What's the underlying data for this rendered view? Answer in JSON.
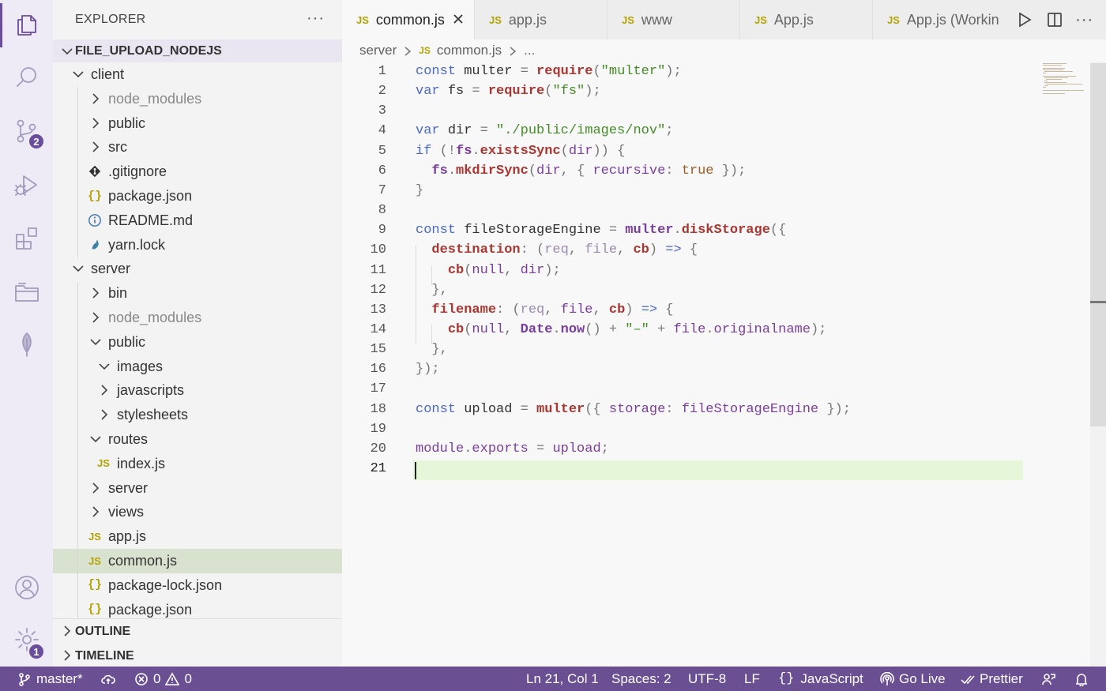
{
  "activity_bar": {
    "items": [
      {
        "name": "explorer",
        "icon": "files-icon",
        "active": true
      },
      {
        "name": "search",
        "icon": "search-icon"
      },
      {
        "name": "source-control",
        "icon": "source-control-icon",
        "badge": "2"
      },
      {
        "name": "run-debug",
        "icon": "debug-icon"
      },
      {
        "name": "extensions",
        "icon": "extensions-icon"
      },
      {
        "name": "remote-explorer",
        "icon": "folder-icon"
      },
      {
        "name": "mongodb",
        "icon": "leaf-icon"
      }
    ],
    "bottom": [
      {
        "name": "accounts",
        "icon": "account-icon"
      },
      {
        "name": "manage",
        "icon": "gear-icon",
        "badge": "1"
      }
    ]
  },
  "sidebar": {
    "title": "EXPLORER",
    "more": "···",
    "project": "FILE_UPLOAD_NODEJS",
    "tree": [
      {
        "label": "client",
        "type": "folder",
        "open": true,
        "depth": 1
      },
      {
        "label": "node_modules",
        "type": "folder",
        "open": false,
        "depth": 2,
        "dim": true
      },
      {
        "label": "public",
        "type": "folder",
        "open": false,
        "depth": 2
      },
      {
        "label": "src",
        "type": "folder",
        "open": false,
        "depth": 2
      },
      {
        "label": ".gitignore",
        "type": "git",
        "depth": 2
      },
      {
        "label": "package.json",
        "type": "json",
        "depth": 2
      },
      {
        "label": "README.md",
        "type": "info",
        "depth": 2
      },
      {
        "label": "yarn.lock",
        "type": "yarn",
        "depth": 2
      },
      {
        "label": "server",
        "type": "folder",
        "open": true,
        "depth": 1
      },
      {
        "label": "bin",
        "type": "folder",
        "open": false,
        "depth": 2
      },
      {
        "label": "node_modules",
        "type": "folder",
        "open": false,
        "depth": 2,
        "dim": true
      },
      {
        "label": "public",
        "type": "folder",
        "open": true,
        "depth": 2
      },
      {
        "label": "images",
        "type": "folder",
        "open": true,
        "depth": 3
      },
      {
        "label": "javascripts",
        "type": "folder",
        "open": false,
        "depth": 3
      },
      {
        "label": "stylesheets",
        "type": "folder",
        "open": false,
        "depth": 3
      },
      {
        "label": "routes",
        "type": "folder",
        "open": true,
        "depth": 2
      },
      {
        "label": "index.js",
        "type": "js",
        "depth": 3
      },
      {
        "label": "server",
        "type": "folder",
        "open": false,
        "depth": 2
      },
      {
        "label": "views",
        "type": "folder",
        "open": false,
        "depth": 2
      },
      {
        "label": "app.js",
        "type": "js",
        "depth": 2
      },
      {
        "label": "common.js",
        "type": "js",
        "depth": 2,
        "selected": true
      },
      {
        "label": "package-lock.json",
        "type": "json",
        "depth": 2
      },
      {
        "label": "package.json",
        "type": "json",
        "depth": 2
      }
    ],
    "sections": [
      "OUTLINE",
      "TIMELINE"
    ]
  },
  "tabs": [
    {
      "label": "common.js",
      "active": true,
      "closable": true
    },
    {
      "label": "app.js"
    },
    {
      "label": "www"
    },
    {
      "label": "App.js"
    },
    {
      "label": "App.js (Working Tree)"
    }
  ],
  "tab_actions": {
    "more": "···"
  },
  "breadcrumb": {
    "folder": "server",
    "file": "common.js",
    "symbol": "..."
  },
  "code": [
    [
      [
        "kw",
        "const "
      ],
      [
        "var",
        "multer "
      ],
      [
        "punc",
        "= "
      ],
      [
        "fn",
        "require"
      ],
      [
        "punc",
        "("
      ],
      [
        "str",
        "\"multer\""
      ],
      [
        "punc",
        ");"
      ]
    ],
    [
      [
        "kw",
        "var "
      ],
      [
        "var",
        "fs "
      ],
      [
        "punc",
        "= "
      ],
      [
        "fn",
        "require"
      ],
      [
        "punc",
        "("
      ],
      [
        "str",
        "\"fs\""
      ],
      [
        "punc",
        ");"
      ]
    ],
    [],
    [
      [
        "kw",
        "var "
      ],
      [
        "var",
        "dir "
      ],
      [
        "punc",
        "= "
      ],
      [
        "str",
        "\"./public/images/nov\""
      ],
      [
        "punc",
        ";"
      ]
    ],
    [
      [
        "kw",
        "if "
      ],
      [
        "punc",
        "(!"
      ],
      [
        "obj",
        "fs"
      ],
      [
        "punc",
        "."
      ],
      [
        "fn",
        "existsSync"
      ],
      [
        "punc",
        "("
      ],
      [
        "prop",
        "dir"
      ],
      [
        "punc",
        ")) {"
      ]
    ],
    [
      [
        "var",
        "  "
      ],
      [
        "obj",
        "fs"
      ],
      [
        "punc",
        "."
      ],
      [
        "fn",
        "mkdirSync"
      ],
      [
        "punc",
        "("
      ],
      [
        "prop",
        "dir"
      ],
      [
        "punc",
        ", { "
      ],
      [
        "prop",
        "recursive"
      ],
      [
        "punc",
        ": "
      ],
      [
        "bool",
        "true"
      ],
      [
        "punc",
        " });"
      ]
    ],
    [
      [
        "punc",
        "}"
      ]
    ],
    [],
    [
      [
        "kw",
        "const "
      ],
      [
        "var",
        "fileStorageEngine "
      ],
      [
        "punc",
        "= "
      ],
      [
        "obj",
        "multer"
      ],
      [
        "punc",
        "."
      ],
      [
        "fn",
        "diskStorage"
      ],
      [
        "punc",
        "({"
      ]
    ],
    [
      [
        "var",
        "  "
      ],
      [
        "fn",
        "destination"
      ],
      [
        "punc",
        ": ("
      ],
      [
        "param",
        "req"
      ],
      [
        "punc",
        ", "
      ],
      [
        "param",
        "file"
      ],
      [
        "punc",
        ", "
      ],
      [
        "fn",
        "cb"
      ],
      [
        "punc",
        ") "
      ],
      [
        "kw",
        "=>"
      ],
      [
        "punc",
        " {"
      ]
    ],
    [
      [
        "var",
        "    "
      ],
      [
        "fn",
        "cb"
      ],
      [
        "punc",
        "("
      ],
      [
        "prop",
        "null"
      ],
      [
        "punc",
        ", "
      ],
      [
        "prop",
        "dir"
      ],
      [
        "punc",
        ");"
      ]
    ],
    [
      [
        "var",
        "  "
      ],
      [
        "punc",
        "},"
      ]
    ],
    [
      [
        "var",
        "  "
      ],
      [
        "fn",
        "filename"
      ],
      [
        "punc",
        ": ("
      ],
      [
        "param",
        "req"
      ],
      [
        "punc",
        ", "
      ],
      [
        "prop",
        "file"
      ],
      [
        "punc",
        ", "
      ],
      [
        "fn",
        "cb"
      ],
      [
        "punc",
        ") "
      ],
      [
        "kw",
        "=>"
      ],
      [
        "punc",
        " {"
      ]
    ],
    [
      [
        "var",
        "    "
      ],
      [
        "fn",
        "cb"
      ],
      [
        "punc",
        "("
      ],
      [
        "prop",
        "null"
      ],
      [
        "punc",
        ", "
      ],
      [
        "obj",
        "Date"
      ],
      [
        "punc",
        "."
      ],
      [
        "obj",
        "now"
      ],
      [
        "punc",
        "() + "
      ],
      [
        "str",
        "\"–\""
      ],
      [
        "punc",
        " + "
      ],
      [
        "prop",
        "file"
      ],
      [
        "punc",
        "."
      ],
      [
        "prop",
        "originalname"
      ],
      [
        "punc",
        ");"
      ]
    ],
    [
      [
        "var",
        "  "
      ],
      [
        "punc",
        "},"
      ]
    ],
    [
      [
        "punc",
        "});"
      ]
    ],
    [],
    [
      [
        "kw",
        "const "
      ],
      [
        "var",
        "upload "
      ],
      [
        "punc",
        "= "
      ],
      [
        "fn",
        "multer"
      ],
      [
        "punc",
        "({ "
      ],
      [
        "prop",
        "storage"
      ],
      [
        "punc",
        ": "
      ],
      [
        "prop",
        "fileStorageEngine"
      ],
      [
        "punc",
        " });"
      ]
    ],
    [],
    [
      [
        "prop",
        "module"
      ],
      [
        "punc",
        "."
      ],
      [
        "prop",
        "exports"
      ],
      [
        "punc",
        " = "
      ],
      [
        "prop",
        "upload"
      ],
      [
        "punc",
        ";"
      ]
    ],
    []
  ],
  "current_line": 21,
  "status_bar": {
    "branch": "master*",
    "errors": "0",
    "warnings": "0",
    "position": "Ln 21, Col 1",
    "spaces": "Spaces: 2",
    "encoding": "UTF-8",
    "eol": "LF",
    "language": "JavaScript",
    "go_live": "Go Live",
    "prettier": "Prettier"
  },
  "colors": {
    "accent": "#6a5093",
    "activity_active": "#6a4d9b",
    "selection": "#d9e2cf",
    "current_line": "#e6f7d9"
  }
}
